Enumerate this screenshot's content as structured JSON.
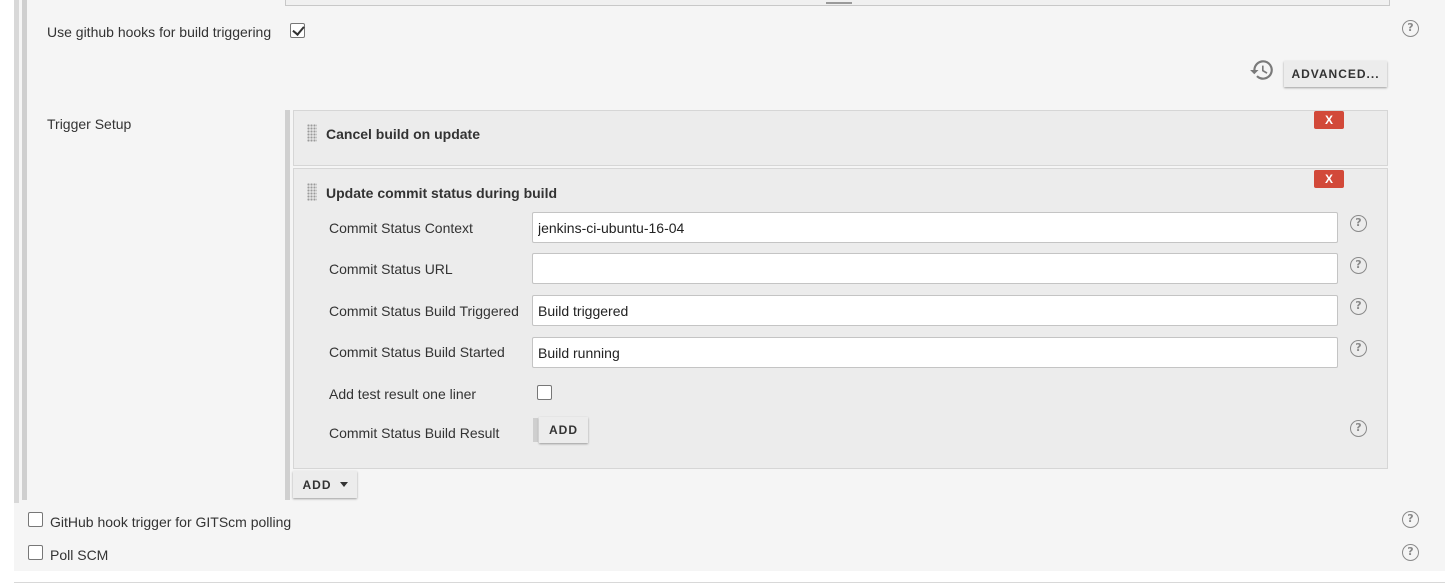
{
  "github_hooks": {
    "label": "Use github hooks for build triggering",
    "checked": true,
    "help_glyph": "?"
  },
  "advanced_button": {
    "label": "ADVANCED...",
    "icon": "history-icon"
  },
  "trigger_setup": {
    "label": "Trigger Setup",
    "remove_label": "X",
    "cancel_block": {
      "title": "Cancel build on update"
    },
    "update_block": {
      "title": "Update commit status during build",
      "fields": [
        {
          "label": "Commit Status Context",
          "value": "jenkins-ci-ubuntu-16-04"
        },
        {
          "label": "Commit Status URL",
          "value": ""
        },
        {
          "label": "Commit Status Build Triggered",
          "value": "Build triggered"
        },
        {
          "label": "Commit Status Build Started",
          "value": "Build running"
        }
      ],
      "one_liner": {
        "label": "Add test result one liner",
        "checked": false
      },
      "build_result": {
        "label": "Commit Status Build Result",
        "add_label": "ADD"
      }
    },
    "add_dropdown_label": "ADD"
  },
  "gitscm_polling": {
    "label": "GitHub hook trigger for GITScm polling",
    "checked": false
  },
  "poll_scm": {
    "label": "Poll SCM",
    "checked": false
  },
  "colors": {
    "remove_red": "#d24939",
    "panel_bg": "#ececec",
    "section_bg": "#f5f5f5"
  }
}
